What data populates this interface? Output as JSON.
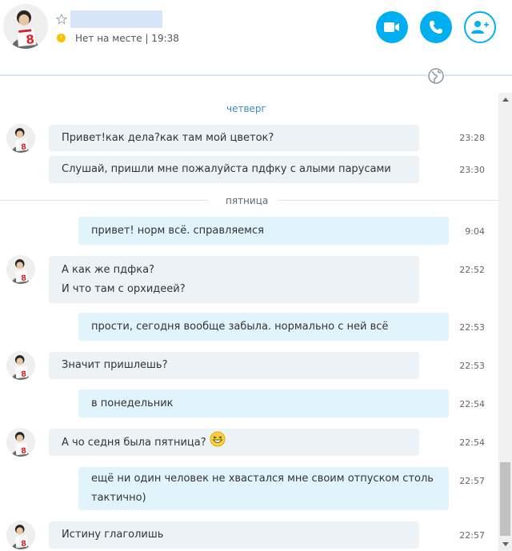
{
  "header": {
    "status_text": "Нет на месте  |  19:38",
    "buttons": {
      "video": "video-call",
      "call": "audio-call",
      "add": "add-person"
    }
  },
  "colors": {
    "accent": "#00aff0",
    "incoming_bubble": "#edf2f7",
    "outgoing_bubble": "#e1f4fb",
    "day_label": "#3f8ac0"
  },
  "days": {
    "thursday": "четверг",
    "friday": "пятница"
  },
  "messages": [
    {
      "text": "Привет!как дела?как там мой цветок?",
      "time": "23:28",
      "dir": "in"
    },
    {
      "text": "Слушай, пришли мне пожалуйста пдфку с алыми парусами",
      "time": "23:30",
      "dir": "in"
    },
    {
      "text": "привет! норм всё. справляемся",
      "time": "9:04",
      "dir": "out"
    },
    {
      "line1": "А как же пдфка?",
      "line2": "И что там с орхидеей?",
      "time": "22:52",
      "dir": "in"
    },
    {
      "text": "прости, сегодня вообще забыла. нормально с ней всё",
      "time": "22:53",
      "dir": "out"
    },
    {
      "text": "Значит пришлешь?",
      "time": "22:53",
      "dir": "in"
    },
    {
      "text": "в понедельник",
      "time": "22:54",
      "dir": "out"
    },
    {
      "text": "А чо седня была пятница?",
      "time": "22:54",
      "dir": "in",
      "emoji": "laughing-emoji"
    },
    {
      "line1": "ещё ни один человек не хвастался мне своим отпуском столь",
      "line2": "тактично)",
      "time": "22:57",
      "dir": "out"
    },
    {
      "text": "Истину глаголишь",
      "time": "22:57",
      "dir": "in"
    }
  ]
}
